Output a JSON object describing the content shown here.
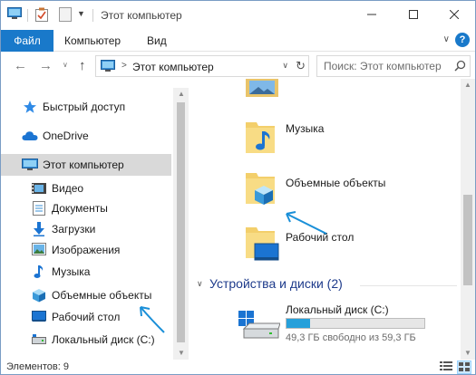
{
  "window": {
    "title": "Этот компьютер"
  },
  "ribbon": {
    "tabs": [
      {
        "label": "Файл"
      },
      {
        "label": "Компьютер"
      },
      {
        "label": "Вид"
      }
    ]
  },
  "address": {
    "path": "Этот компьютер",
    "search_placeholder": "Поиск: Этот компьютер"
  },
  "sidebar": {
    "items": [
      {
        "label": "Быстрый доступ",
        "icon": "star-icon"
      },
      {
        "label": "OneDrive",
        "icon": "cloud-icon"
      },
      {
        "label": "Этот компьютер",
        "icon": "computer-icon",
        "selected": true
      },
      {
        "label": "Видео",
        "icon": "video-icon"
      },
      {
        "label": "Документы",
        "icon": "documents-icon"
      },
      {
        "label": "Загрузки",
        "icon": "downloads-icon"
      },
      {
        "label": "Изображения",
        "icon": "pictures-icon"
      },
      {
        "label": "Музыка",
        "icon": "music-icon"
      },
      {
        "label": "Объемные объекты",
        "icon": "3d-objects-icon"
      },
      {
        "label": "Рабочий стол",
        "icon": "desktop-icon"
      },
      {
        "label": "Локальный диск (C:)",
        "icon": "drive-icon"
      }
    ]
  },
  "main": {
    "folders": [
      {
        "label": "Музыка",
        "icon": "music-folder-icon"
      },
      {
        "label": "Объемные объекты",
        "icon": "3d-objects-folder-icon"
      },
      {
        "label": "Рабочий стол",
        "icon": "desktop-folder-icon"
      }
    ],
    "devices_header": "Устройства и диски (2)",
    "disk": {
      "name": "Локальный диск (C:)",
      "free_text": "49,3 ГБ свободно из 59,3 ГБ",
      "used_fraction": 0.17
    }
  },
  "status": {
    "text": "Элементов: 9"
  },
  "colors": {
    "accent": "#1979ca",
    "selection": "#d9d9d9",
    "group_header": "#1e3b8b",
    "disk_fill": "#26a0da",
    "annotation": "#1a8fd8"
  }
}
